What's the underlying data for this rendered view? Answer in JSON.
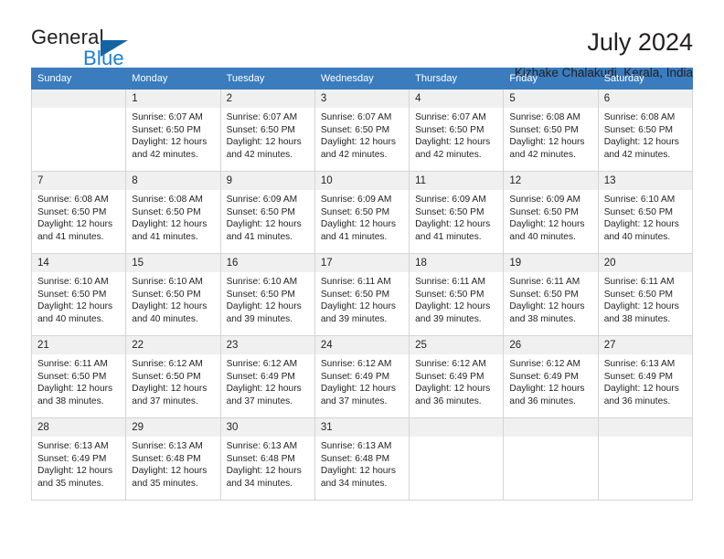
{
  "brand": {
    "name_top": "General",
    "name_bottom": "Blue",
    "triangle_color": "#1464a5",
    "blue_color": "#1a7fd4"
  },
  "header": {
    "title": "July 2024",
    "subtitle": "Kizhake Chalakudi, Kerala, India"
  },
  "theme": {
    "header_bg": "#3a7cbe",
    "header_text": "#ffffff",
    "daynum_bg": "#f0f0f0",
    "grid_line": "#d5d5d5",
    "text": "#231f20"
  },
  "calendar": {
    "weekday_headers": [
      "Sunday",
      "Monday",
      "Tuesday",
      "Wednesday",
      "Thursday",
      "Friday",
      "Saturday"
    ],
    "weeks": [
      [
        {
          "day": "",
          "lines": []
        },
        {
          "day": "1",
          "lines": [
            "Sunrise: 6:07 AM",
            "Sunset: 6:50 PM",
            "Daylight: 12 hours",
            "and 42 minutes."
          ]
        },
        {
          "day": "2",
          "lines": [
            "Sunrise: 6:07 AM",
            "Sunset: 6:50 PM",
            "Daylight: 12 hours",
            "and 42 minutes."
          ]
        },
        {
          "day": "3",
          "lines": [
            "Sunrise: 6:07 AM",
            "Sunset: 6:50 PM",
            "Daylight: 12 hours",
            "and 42 minutes."
          ]
        },
        {
          "day": "4",
          "lines": [
            "Sunrise: 6:07 AM",
            "Sunset: 6:50 PM",
            "Daylight: 12 hours",
            "and 42 minutes."
          ]
        },
        {
          "day": "5",
          "lines": [
            "Sunrise: 6:08 AM",
            "Sunset: 6:50 PM",
            "Daylight: 12 hours",
            "and 42 minutes."
          ]
        },
        {
          "day": "6",
          "lines": [
            "Sunrise: 6:08 AM",
            "Sunset: 6:50 PM",
            "Daylight: 12 hours",
            "and 42 minutes."
          ]
        }
      ],
      [
        {
          "day": "7",
          "lines": [
            "Sunrise: 6:08 AM",
            "Sunset: 6:50 PM",
            "Daylight: 12 hours",
            "and 41 minutes."
          ]
        },
        {
          "day": "8",
          "lines": [
            "Sunrise: 6:08 AM",
            "Sunset: 6:50 PM",
            "Daylight: 12 hours",
            "and 41 minutes."
          ]
        },
        {
          "day": "9",
          "lines": [
            "Sunrise: 6:09 AM",
            "Sunset: 6:50 PM",
            "Daylight: 12 hours",
            "and 41 minutes."
          ]
        },
        {
          "day": "10",
          "lines": [
            "Sunrise: 6:09 AM",
            "Sunset: 6:50 PM",
            "Daylight: 12 hours",
            "and 41 minutes."
          ]
        },
        {
          "day": "11",
          "lines": [
            "Sunrise: 6:09 AM",
            "Sunset: 6:50 PM",
            "Daylight: 12 hours",
            "and 41 minutes."
          ]
        },
        {
          "day": "12",
          "lines": [
            "Sunrise: 6:09 AM",
            "Sunset: 6:50 PM",
            "Daylight: 12 hours",
            "and 40 minutes."
          ]
        },
        {
          "day": "13",
          "lines": [
            "Sunrise: 6:10 AM",
            "Sunset: 6:50 PM",
            "Daylight: 12 hours",
            "and 40 minutes."
          ]
        }
      ],
      [
        {
          "day": "14",
          "lines": [
            "Sunrise: 6:10 AM",
            "Sunset: 6:50 PM",
            "Daylight: 12 hours",
            "and 40 minutes."
          ]
        },
        {
          "day": "15",
          "lines": [
            "Sunrise: 6:10 AM",
            "Sunset: 6:50 PM",
            "Daylight: 12 hours",
            "and 40 minutes."
          ]
        },
        {
          "day": "16",
          "lines": [
            "Sunrise: 6:10 AM",
            "Sunset: 6:50 PM",
            "Daylight: 12 hours",
            "and 39 minutes."
          ]
        },
        {
          "day": "17",
          "lines": [
            "Sunrise: 6:11 AM",
            "Sunset: 6:50 PM",
            "Daylight: 12 hours",
            "and 39 minutes."
          ]
        },
        {
          "day": "18",
          "lines": [
            "Sunrise: 6:11 AM",
            "Sunset: 6:50 PM",
            "Daylight: 12 hours",
            "and 39 minutes."
          ]
        },
        {
          "day": "19",
          "lines": [
            "Sunrise: 6:11 AM",
            "Sunset: 6:50 PM",
            "Daylight: 12 hours",
            "and 38 minutes."
          ]
        },
        {
          "day": "20",
          "lines": [
            "Sunrise: 6:11 AM",
            "Sunset: 6:50 PM",
            "Daylight: 12 hours",
            "and 38 minutes."
          ]
        }
      ],
      [
        {
          "day": "21",
          "lines": [
            "Sunrise: 6:11 AM",
            "Sunset: 6:50 PM",
            "Daylight: 12 hours",
            "and 38 minutes."
          ]
        },
        {
          "day": "22",
          "lines": [
            "Sunrise: 6:12 AM",
            "Sunset: 6:50 PM",
            "Daylight: 12 hours",
            "and 37 minutes."
          ]
        },
        {
          "day": "23",
          "lines": [
            "Sunrise: 6:12 AM",
            "Sunset: 6:49 PM",
            "Daylight: 12 hours",
            "and 37 minutes."
          ]
        },
        {
          "day": "24",
          "lines": [
            "Sunrise: 6:12 AM",
            "Sunset: 6:49 PM",
            "Daylight: 12 hours",
            "and 37 minutes."
          ]
        },
        {
          "day": "25",
          "lines": [
            "Sunrise: 6:12 AM",
            "Sunset: 6:49 PM",
            "Daylight: 12 hours",
            "and 36 minutes."
          ]
        },
        {
          "day": "26",
          "lines": [
            "Sunrise: 6:12 AM",
            "Sunset: 6:49 PM",
            "Daylight: 12 hours",
            "and 36 minutes."
          ]
        },
        {
          "day": "27",
          "lines": [
            "Sunrise: 6:13 AM",
            "Sunset: 6:49 PM",
            "Daylight: 12 hours",
            "and 36 minutes."
          ]
        }
      ],
      [
        {
          "day": "28",
          "lines": [
            "Sunrise: 6:13 AM",
            "Sunset: 6:49 PM",
            "Daylight: 12 hours",
            "and 35 minutes."
          ]
        },
        {
          "day": "29",
          "lines": [
            "Sunrise: 6:13 AM",
            "Sunset: 6:48 PM",
            "Daylight: 12 hours",
            "and 35 minutes."
          ]
        },
        {
          "day": "30",
          "lines": [
            "Sunrise: 6:13 AM",
            "Sunset: 6:48 PM",
            "Daylight: 12 hours",
            "and 34 minutes."
          ]
        },
        {
          "day": "31",
          "lines": [
            "Sunrise: 6:13 AM",
            "Sunset: 6:48 PM",
            "Daylight: 12 hours",
            "and 34 minutes."
          ]
        },
        {
          "day": "",
          "lines": []
        },
        {
          "day": "",
          "lines": []
        },
        {
          "day": "",
          "lines": []
        }
      ]
    ]
  }
}
